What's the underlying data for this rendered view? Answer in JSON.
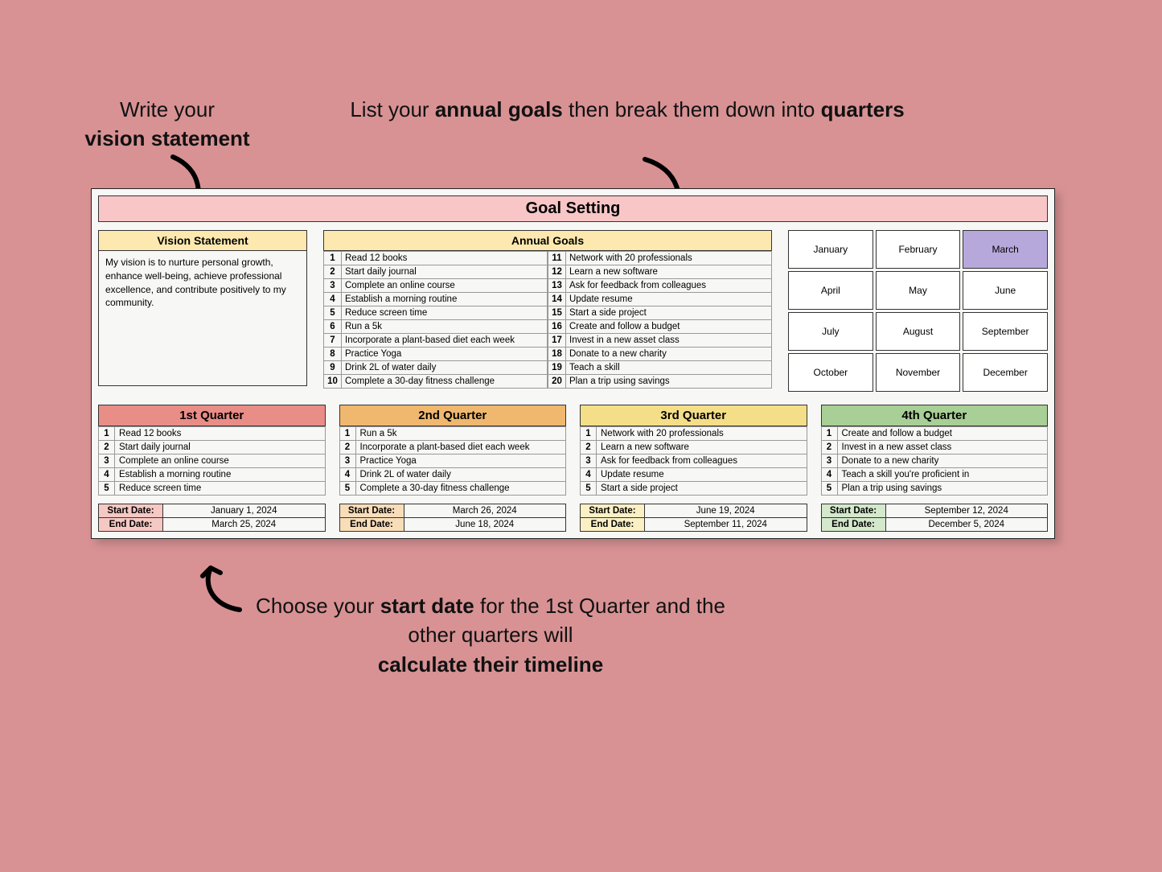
{
  "callouts": {
    "vision_line1": "Write your",
    "vision_bold": "vision statement",
    "annual_pre": "List your ",
    "annual_b1": "annual goals",
    "annual_mid": " then break them down into ",
    "annual_b2": "quarters",
    "dates_pre": "Choose your ",
    "dates_b1": "start date",
    "dates_mid1": " for the 1st Quarter and the other quarters will ",
    "dates_b2": "calculate their timeline"
  },
  "title": "Goal Setting",
  "vision": {
    "header": "Vision Statement",
    "text": "My vision is to nurture personal growth, enhance well-being, achieve professional excellence, and contribute positively to my community."
  },
  "annual": {
    "header": "Annual Goals",
    "left": [
      "Read 12 books",
      "Start daily journal",
      "Complete an online course",
      "Establish a morning routine",
      "Reduce screen time",
      "Run a 5k",
      "Incorporate a plant-based diet each week",
      "Practice Yoga",
      "Drink 2L of water daily",
      "Complete a 30-day fitness challenge"
    ],
    "right": [
      "Network with 20 professionals",
      "Learn a new software",
      "Ask for feedback from colleagues",
      "Update resume",
      "Start a side project",
      "Create and follow a budget",
      "Invest in a new asset class",
      "Donate to a new charity",
      "Teach a skill",
      "Plan a trip using savings"
    ]
  },
  "months": [
    "January",
    "February",
    "March",
    "April",
    "May",
    "June",
    "July",
    "August",
    "September",
    "October",
    "November",
    "December"
  ],
  "highlight_month_index": 2,
  "quarters": [
    {
      "title": "1st Quarter",
      "items": [
        "Read 12 books",
        "Start daily journal",
        "Complete an online course",
        "Establish a morning routine",
        "Reduce screen time"
      ],
      "start": "January 1, 2024",
      "end": "March 25, 2024"
    },
    {
      "title": "2nd Quarter",
      "items": [
        "Run a 5k",
        "Incorporate a plant-based diet each week",
        "Practice Yoga",
        "Drink 2L of water daily",
        "Complete a 30-day fitness challenge"
      ],
      "start": "March 26, 2024",
      "end": "June 18, 2024"
    },
    {
      "title": "3rd Quarter",
      "items": [
        "Network with 20 professionals",
        "Learn a new software",
        "Ask for feedback from colleagues",
        "Update resume",
        "Start a side project"
      ],
      "start": "June 19, 2024",
      "end": "September 11, 2024"
    },
    {
      "title": "4th Quarter",
      "items": [
        "Create and follow a budget",
        "Invest in a new asset class",
        "Donate to a new charity",
        "Teach a skill you're proficient in",
        "Plan a trip using savings"
      ],
      "start": "September 12, 2024",
      "end": "December 5, 2024"
    }
  ],
  "labels": {
    "start": "Start Date:",
    "end": "End Date:"
  }
}
